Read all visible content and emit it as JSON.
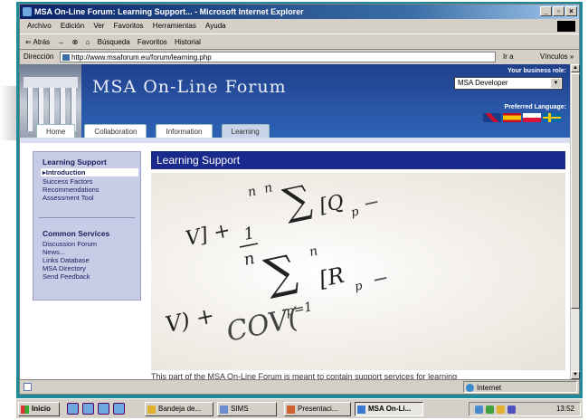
{
  "browser": {
    "title": "MSA On-Line Forum: Learning Support... - Microsoft Internet Explorer",
    "window_buttons": [
      "_",
      "▫",
      "×"
    ],
    "menu": [
      "Archivo",
      "Edición",
      "Ver",
      "Favoritos",
      "Herramientas",
      "Ayuda"
    ],
    "toolbar": [
      "⇐ Atrás",
      "→",
      "⊗",
      "⌂",
      "Búsqueda",
      "Favoritos",
      "Historial"
    ],
    "address_label": "Dirección",
    "address_url": "http://www.msaforum.eu/forum/learning.php",
    "go_label": "Ir a",
    "links_label": "Vínculos »"
  },
  "site": {
    "title": "MSA On-Line Forum",
    "role_label": "Your business role:",
    "role_value": "MSA Developer",
    "lang_label": "Preferred Language:",
    "flags": [
      "uk",
      "es",
      "pl",
      "se"
    ],
    "tabs": [
      {
        "label": "Home",
        "active": false
      },
      {
        "label": "Collaboration",
        "active": false
      },
      {
        "label": "Information",
        "active": false
      },
      {
        "label": "Learning",
        "active": true
      }
    ]
  },
  "sidenav": {
    "learning_heading": "Learning Support",
    "learning_items": [
      {
        "label": "▸Introduction",
        "selected": true
      },
      {
        "label": "Success Factors",
        "selected": false
      },
      {
        "label": "Recommendations",
        "selected": false
      },
      {
        "label": "Assessment Tool",
        "selected": false
      }
    ],
    "common_heading": "Common Services",
    "common_items": [
      "Discussion Forum",
      "News...",
      "Links Database",
      "MSA Directory",
      "Send Feedback"
    ]
  },
  "main": {
    "heading": "Learning Support",
    "intro_text": "This part of the MSA On-Line Forum is meant to contain support services for learning"
  },
  "statusbar": {
    "zone": "Internet"
  },
  "taskbar": {
    "start_label": "Inicio",
    "tasks": [
      {
        "label": "Bandeja de...",
        "active": false
      },
      {
        "label": "SIMS",
        "active": false
      },
      {
        "label": "Presentaci...",
        "active": false
      },
      {
        "label": "MSA On-Li...",
        "active": true
      }
    ],
    "clock": "13:52"
  }
}
